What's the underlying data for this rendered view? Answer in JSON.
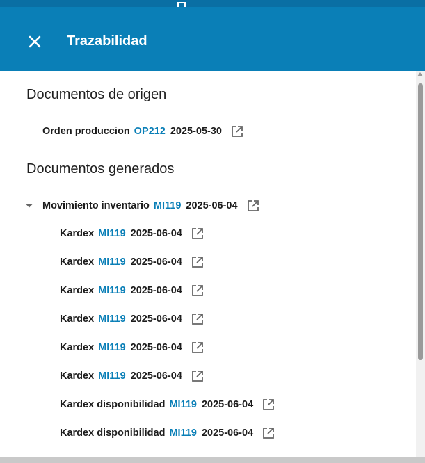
{
  "header": {
    "title": "Trazabilidad",
    "close_icon": "close-icon"
  },
  "colors": {
    "header": "#0a7fb7",
    "link": "#0a7fb7"
  },
  "origin": {
    "heading": "Documentos de origen",
    "items": [
      {
        "label": "Orden produccion",
        "code": "OP212",
        "date": "2025-05-30",
        "icon": "open-external-icon"
      }
    ]
  },
  "generated": {
    "heading": "Documentos generados",
    "parent": {
      "label": "Movimiento inventario",
      "code": "MI119",
      "date": "2025-06-04",
      "icon": "open-external-icon",
      "expand_icon": "caret-down-icon"
    },
    "children": [
      {
        "label": "Kardex",
        "code": "MI119",
        "date": "2025-06-04"
      },
      {
        "label": "Kardex",
        "code": "MI119",
        "date": "2025-06-04"
      },
      {
        "label": "Kardex",
        "code": "MI119",
        "date": "2025-06-04"
      },
      {
        "label": "Kardex",
        "code": "MI119",
        "date": "2025-06-04"
      },
      {
        "label": "Kardex",
        "code": "MI119",
        "date": "2025-06-04"
      },
      {
        "label": "Kardex",
        "code": "MI119",
        "date": "2025-06-04"
      },
      {
        "label": "Kardex disponibilidad",
        "code": "MI119",
        "date": "2025-06-04"
      },
      {
        "label": "Kardex disponibilidad",
        "code": "MI119",
        "date": "2025-06-04"
      }
    ]
  }
}
